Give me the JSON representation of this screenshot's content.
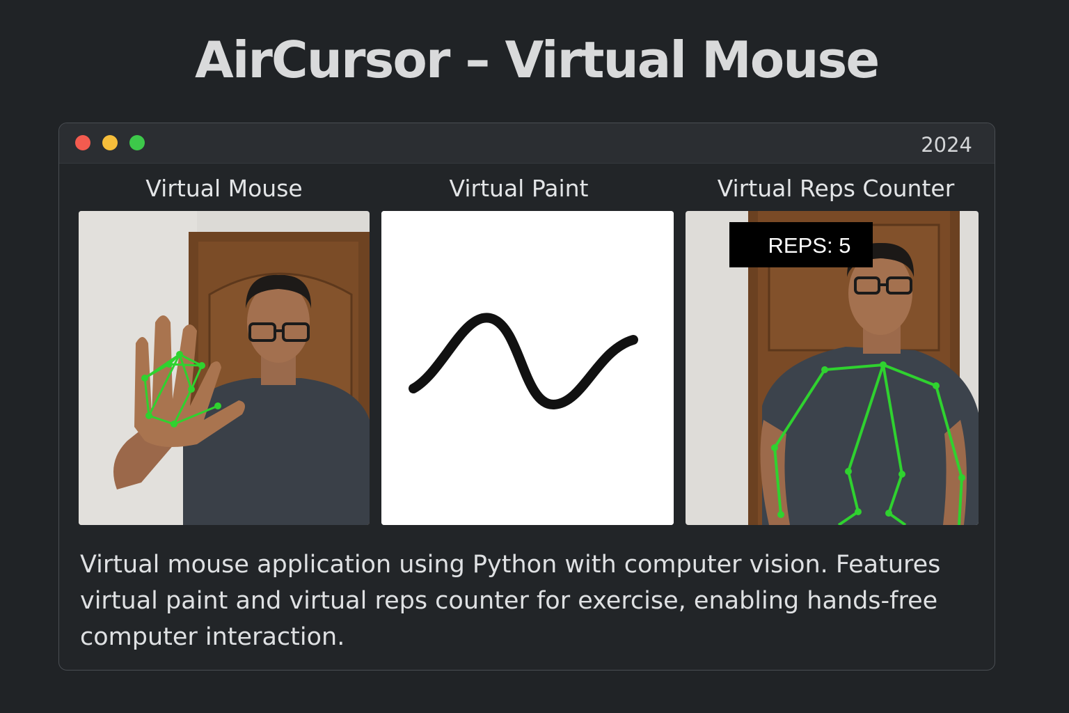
{
  "page": {
    "title": "AirCursor – Virtual Mouse"
  },
  "window": {
    "year": "2024",
    "controls": [
      "close-icon",
      "minimize-icon",
      "maximize-icon"
    ],
    "control_colors": [
      "#f35b4f",
      "#f6be3b",
      "#3dc84a"
    ]
  },
  "panels": [
    {
      "label": "Virtual Mouse",
      "content": "camera-feed-hand-tracking"
    },
    {
      "label": "Virtual Paint",
      "content": "paint-canvas-stroke"
    },
    {
      "label": "Virtual Reps Counter",
      "content": "camera-feed-pose-tracking",
      "overlay": "REPS: 5"
    }
  ],
  "description": "Virtual mouse application using Python with computer vision. Features virtual paint and virtual reps counter for exercise, enabling hands-free computer interaction.",
  "colors": {
    "background": "#202326",
    "tracking_lines": "#2fd22f"
  }
}
